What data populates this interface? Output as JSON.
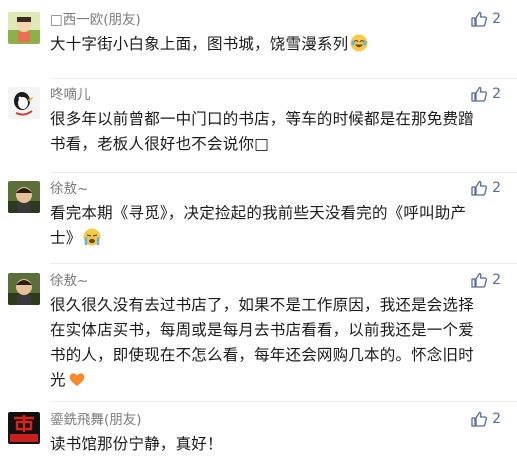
{
  "comments": [
    {
      "name": "□西一欧(朋友)",
      "likes": "2",
      "lines": [
        "大十字街小白象上面，图书城，饶雪漫系列"
      ],
      "emoji": "laughing-tears"
    },
    {
      "name": "咚嘀儿",
      "likes": "2",
      "lines": [
        "很多年以前曾都一中门口的书店，等车的时候都是在那免费蹭",
        "书看，老板人很好也不会说你□"
      ],
      "emoji": ""
    },
    {
      "name": "徐敖~",
      "likes": "2",
      "lines": [
        "看完本期《寻觅》，决定捡起的我前些天没看完的《呼叫助产",
        "士》"
      ],
      "emoji": "crying-face"
    },
    {
      "name": "徐敖~",
      "likes": "2",
      "lines": [
        "很久很久没有去过书店了，如果不是工作原因，我还是会选择",
        "在实体店买书，每周或是每月去书店看看，以前我还是一个爱",
        "书的人，即使现在不怎么看，每年还会网购几本的。怀念旧时",
        "光"
      ],
      "emoji": "orange-heart"
    },
    {
      "name": "鎏銑飛舞(朋友)",
      "likes": "2",
      "lines": [
        "读书馆那份宁静，真好！"
      ],
      "emoji": ""
    }
  ],
  "colors": {
    "name": "#7b7b7b",
    "like": "#576b95",
    "text": "#1a1a1a",
    "separator": "#ececec"
  },
  "icons": {
    "like": "thumbs-up-icon"
  }
}
